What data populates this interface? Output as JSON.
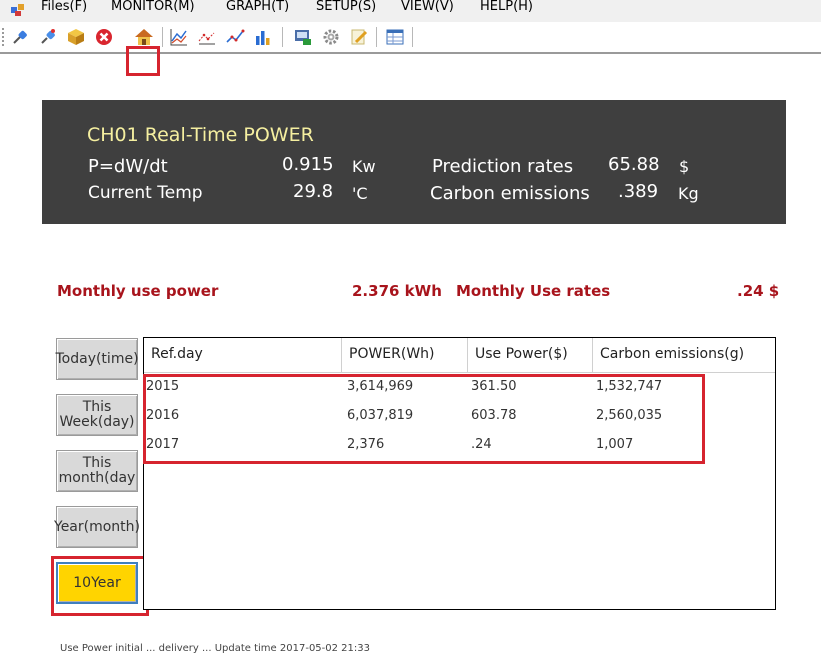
{
  "menu": [
    "Files(F)",
    "MONITOR(M)",
    "GRAPH(T)",
    "SETUP(S)",
    "VIEW(V)",
    "HELP(H)"
  ],
  "toolbar_icons": [
    "connect-plug-icon",
    "disconnect-plug-icon",
    "box-icon",
    "close-red-icon",
    "home-icon",
    "chart-line-icon",
    "chart-dots-icon",
    "chart-trend-icon",
    "chart-bar-icon",
    "save-monitor-icon",
    "gear-icon",
    "edit-pencil-icon",
    "table-window-icon"
  ],
  "realtime": {
    "title": "CH01  Real-Time POWER",
    "power_label": "P=dW/dt",
    "power_value": "0.915",
    "power_unit": "Kw",
    "temp_label": "Current Temp",
    "temp_value": "29.8",
    "temp_unit": "'C",
    "pred_label": "Prediction rates",
    "pred_value": "65.88",
    "pred_unit": "$",
    "carbon_label": "Carbon emissions",
    "carbon_value": ".389",
    "carbon_unit": "Kg"
  },
  "monthly": {
    "use_power_label": "Monthly use power",
    "use_power_value": "2.376 kWh",
    "use_rates_label": "Monthly Use rates",
    "use_rates_value": ".24 $"
  },
  "side_buttons": [
    "Today(time)",
    "This Week(day)",
    "This month(day",
    "Year(month)",
    "10Year"
  ],
  "table": {
    "headers": [
      "Ref.day",
      "POWER(Wh)",
      "Use Power($)",
      "Carbon emissions(g)"
    ],
    "rows": [
      [
        "2015",
        "3,614,969",
        "361.50",
        "1,532,747"
      ],
      [
        "2016",
        "6,037,819",
        "603.78",
        "2,560,035"
      ],
      [
        "2017",
        "2,376",
        ".24",
        "1,007"
      ]
    ]
  },
  "footer_partial": "Use Power   initial   ...   delivery   ...   Update time  2017-05-02 21:33"
}
